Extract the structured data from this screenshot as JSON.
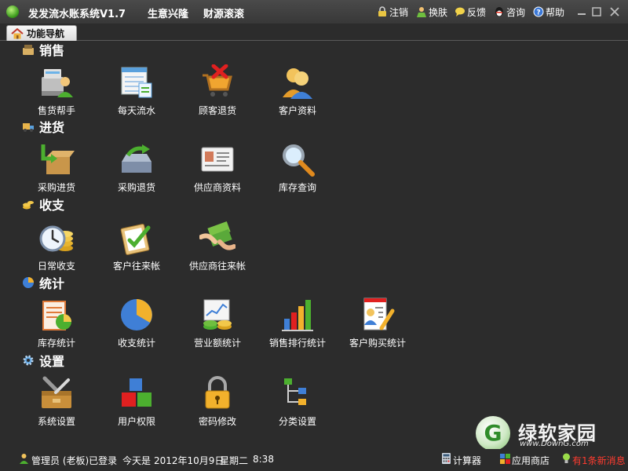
{
  "titlebar": {
    "app_title": "发发流水账系统V1.7",
    "slogan1": "生意兴隆",
    "slogan2": "财源滚滚",
    "links": {
      "logout": "注销",
      "skin": "换肤",
      "feedback": "反馈",
      "consult": "咨询",
      "help": "帮助"
    }
  },
  "tab": {
    "label": "功能导航"
  },
  "sections": {
    "sales": {
      "title": "销售",
      "items": [
        "售货帮手",
        "每天流水",
        "顾客退货",
        "客户资料"
      ]
    },
    "purchase": {
      "title": "进货",
      "items": [
        "采购进货",
        "采购退货",
        "供应商资料",
        "库存查询"
      ]
    },
    "finance": {
      "title": "收支",
      "items": [
        "日常收支",
        "客户往来帐",
        "供应商往来帐"
      ]
    },
    "stats": {
      "title": "统计",
      "items": [
        "库存统计",
        "收支统计",
        "营业额统计",
        "销售排行统计",
        "客户购买统计"
      ]
    },
    "settings": {
      "title": "设置",
      "items": [
        "系统设置",
        "用户权限",
        "密码修改",
        "分类设置"
      ]
    }
  },
  "logo": {
    "name": "绿软家园",
    "url": "www.DownG.com"
  },
  "statusbar": {
    "user": "管理员 (老板)已登录",
    "today_label": "今天是",
    "date": "2012年10月9日",
    "weekday": "星期二",
    "time": "8:38",
    "calculator": "计算器",
    "app_store": "应用商店",
    "messages": "有1条新消息"
  },
  "colors": {
    "background": "#2c2c2c",
    "accent_green": "#4caf2f",
    "message_red": "#ff3b2f"
  }
}
